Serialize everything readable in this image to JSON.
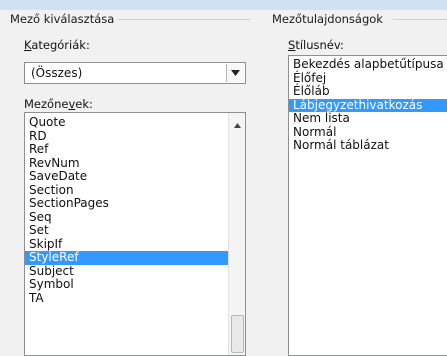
{
  "left_group": {
    "title": "Mező kiválasztása",
    "category_label_prefix": "K",
    "category_label_rest": "ategóriák:",
    "category_value": "(Összes)",
    "names_label_prefix": "Mezőne",
    "names_label_mnemonic": "v",
    "names_label_rest": "ek:",
    "field_names": [
      "Quote",
      "RD",
      "Ref",
      "RevNum",
      "SaveDate",
      "Section",
      "SectionPages",
      "Seq",
      "Set",
      "SkipIf",
      "StyleRef",
      "Subject",
      "Symbol",
      "TA"
    ],
    "selected_field": "StyleRef"
  },
  "right_group": {
    "title": "Mezőtulajdonságok",
    "style_label_prefix": "S",
    "style_label_rest": "tílusnév:",
    "styles": [
      "Bekezdés alapbetűtípusa",
      "Élőfej",
      "Élőláb",
      "Lábjegyzethivatkozás",
      "Nem lista",
      "Normál",
      "Normál táblázat"
    ],
    "selected_style": "Lábjegyzethivatkozás"
  },
  "icons": {
    "dropdown": "chevron-down-icon",
    "scroll_up": "scroll-up-arrow-icon",
    "scroll_down": "scroll-down-arrow-icon"
  }
}
